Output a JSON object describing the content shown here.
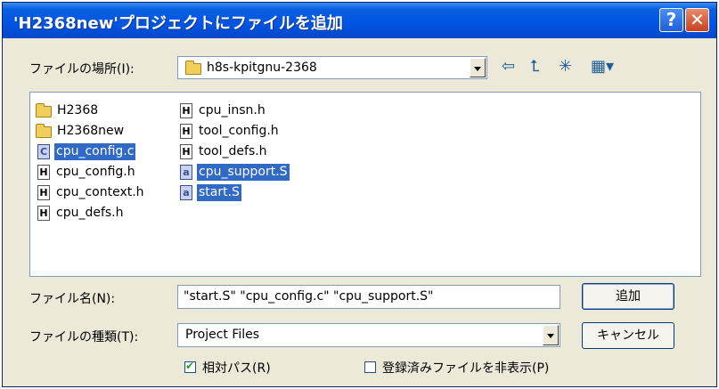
{
  "dialog": {
    "title": "'H2368new'プロジェクトにファイルを追加",
    "help_glyph": "?",
    "close_glyph": "✕"
  },
  "lookin": {
    "label": "ファイルの場所(I):",
    "value": "h8s-kpitgnu-2368"
  },
  "toolbar": {
    "back_glyph": "⇦",
    "up_glyph": "⮤",
    "newfolder_glyph": "✳",
    "views_glyph": "▦▾"
  },
  "files": {
    "col1": [
      {
        "name": "H2368",
        "icon": "folder-icon",
        "selected": false
      },
      {
        "name": "H2368new",
        "icon": "folder-icon",
        "selected": false
      },
      {
        "name": "cpu_config.c",
        "icon": "c-file-icon",
        "glyph": "C",
        "selected": true
      },
      {
        "name": "cpu_config.h",
        "icon": "h-file-icon",
        "glyph": "H",
        "selected": false
      },
      {
        "name": "cpu_context.h",
        "icon": "h-file-icon",
        "glyph": "H",
        "selected": false
      },
      {
        "name": "cpu_defs.h",
        "icon": "h-file-icon",
        "glyph": "H",
        "selected": false
      }
    ],
    "col2": [
      {
        "name": "cpu_insn.h",
        "icon": "h-file-icon",
        "glyph": "H",
        "selected": false
      },
      {
        "name": "tool_config.h",
        "icon": "h-file-icon",
        "glyph": "H",
        "selected": false
      },
      {
        "name": "tool_defs.h",
        "icon": "h-file-icon",
        "glyph": "H",
        "selected": false
      },
      {
        "name": "cpu_support.S",
        "icon": "asm-file-icon",
        "glyph": "a",
        "selected": true
      },
      {
        "name": "start.S",
        "icon": "asm-file-icon",
        "glyph": "a",
        "selected": true
      }
    ]
  },
  "filename": {
    "label": "ファイル名(N):",
    "value": "\"start.S\" \"cpu_config.c\" \"cpu_support.S\""
  },
  "filetype": {
    "label": "ファイルの種類(T):",
    "value": "Project Files"
  },
  "buttons": {
    "add": "追加",
    "cancel": "キャンセル"
  },
  "options": {
    "relative_path": {
      "label": "相対パス(R)",
      "checked": true
    },
    "hide_registered": {
      "label": "登録済みファイルを非表示(P)",
      "checked": false
    }
  },
  "colors": {
    "title_bar": "#0054e3",
    "selection": "#316ac5",
    "dialog_bg": "#ece9d8"
  }
}
